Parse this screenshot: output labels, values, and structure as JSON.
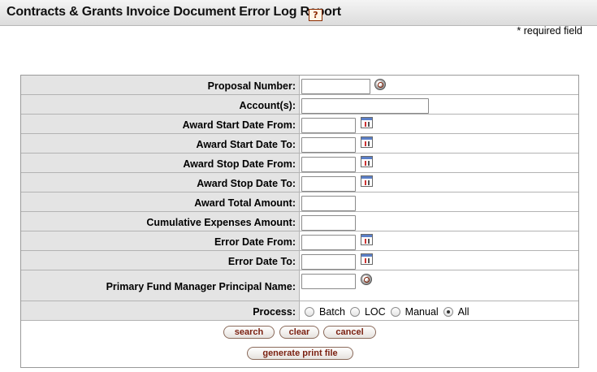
{
  "header": {
    "title": "Contracts & Grants Invoice Document Error Log Report",
    "help_icon": "help-icon",
    "required_note": "* required field"
  },
  "form": {
    "fields": [
      {
        "label": "Proposal Number:",
        "value": "",
        "icon": "lookup-icon"
      },
      {
        "label": "Account(s):",
        "value": ""
      },
      {
        "label": "Award Start Date From:",
        "value": "",
        "icon": "calendar-icon"
      },
      {
        "label": "Award Start Date To:",
        "value": "",
        "icon": "calendar-icon"
      },
      {
        "label": "Award Stop Date From:",
        "value": "",
        "icon": "calendar-icon"
      },
      {
        "label": "Award Stop Date To:",
        "value": "",
        "icon": "calendar-icon"
      },
      {
        "label": "Award Total Amount:",
        "value": ""
      },
      {
        "label": "Cumulative Expenses Amount:",
        "value": ""
      },
      {
        "label": "Error Date From:",
        "value": "",
        "icon": "calendar-icon"
      },
      {
        "label": "Error Date To:",
        "value": "",
        "icon": "calendar-icon"
      },
      {
        "label": "Primary Fund Manager Principal Name:",
        "value": "",
        "icon": "lookup-icon"
      }
    ],
    "process": {
      "label": "Process:",
      "options": [
        "Batch",
        "LOC",
        "Manual",
        "All"
      ],
      "selected": "All"
    }
  },
  "buttons": {
    "search": "search",
    "clear": "clear",
    "cancel": "cancel",
    "generate": "generate print file"
  }
}
